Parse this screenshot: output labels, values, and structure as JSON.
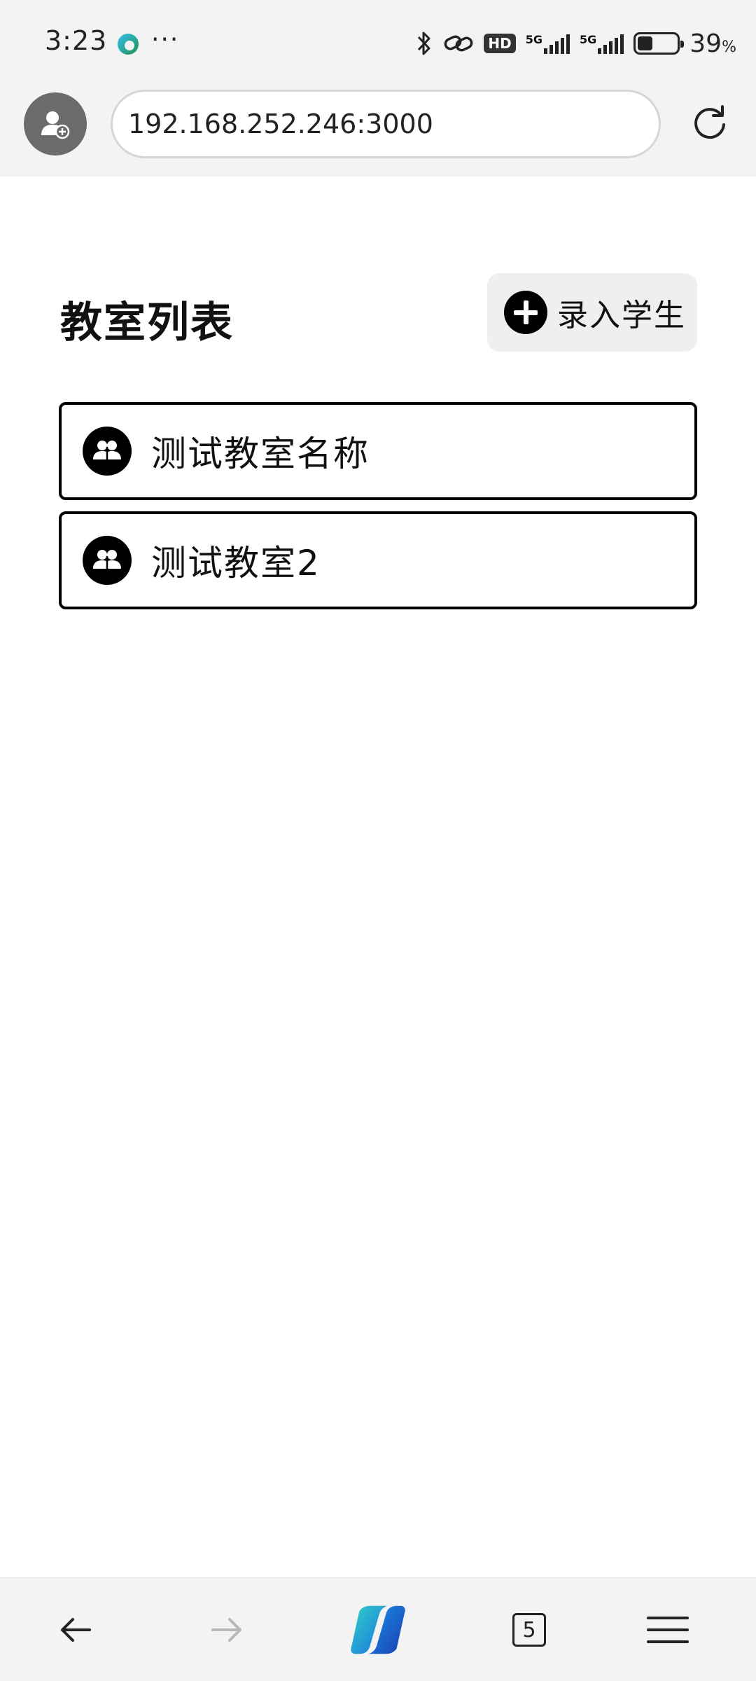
{
  "status_bar": {
    "time": "3:23",
    "overflow": "···",
    "network_badge": "HD",
    "signal1_label": "5G",
    "signal2_label": "5G",
    "battery_percent": "39",
    "battery_unit": "%",
    "battery_level": 0.39,
    "icons": [
      "edge-icon",
      "bluetooth-icon",
      "link-icon",
      "battery-icon"
    ]
  },
  "browser": {
    "url": "192.168.252.246:3000",
    "profile_icon": "add-user-icon",
    "reload_icon": "reload-icon"
  },
  "page": {
    "title": "教室列表",
    "add_student_label": "录入学生",
    "classrooms": [
      {
        "name": "测试教室名称"
      },
      {
        "name": "测试教室2"
      }
    ]
  },
  "bottom_nav": {
    "tab_count": "5",
    "icons": [
      "back-arrow-icon",
      "forward-arrow-icon",
      "copilot-icon",
      "tabs-icon",
      "menu-icon"
    ]
  },
  "colors": {
    "bar_background": "#f3f3f3",
    "accent": "#000000",
    "button_background": "#efefef"
  }
}
